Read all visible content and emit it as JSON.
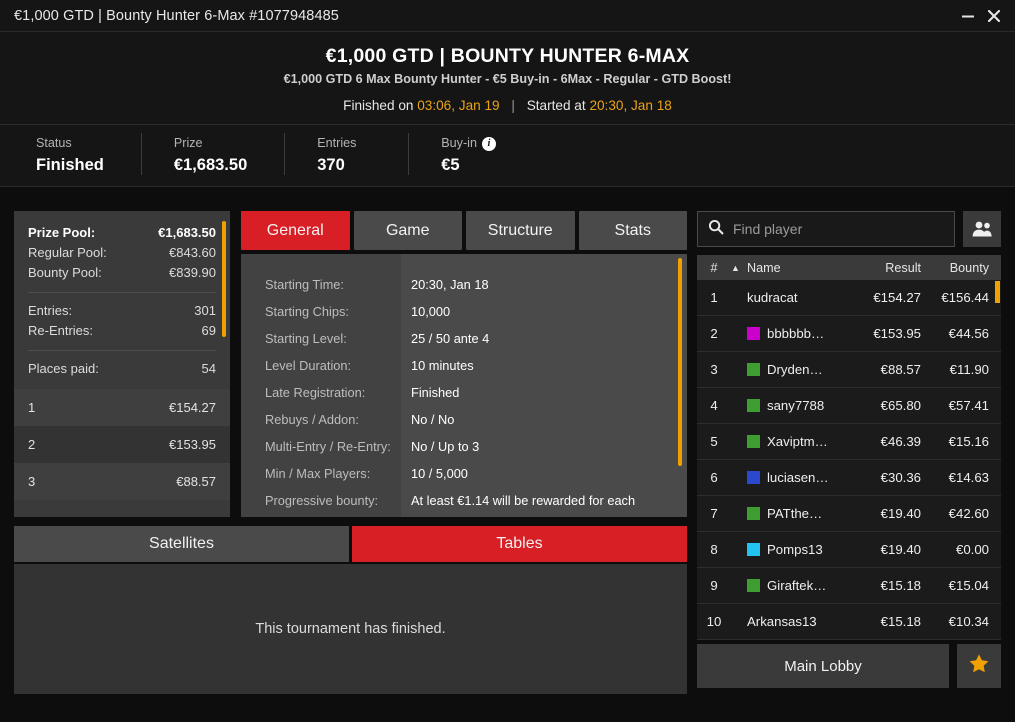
{
  "window": {
    "title": "€1,000 GTD | Bounty Hunter 6-Max #1077948485",
    "minimize_label": "minimize",
    "close_label": "close"
  },
  "header": {
    "title": "€1,000 GTD | BOUNTY HUNTER 6-MAX",
    "subtitle": "€1,000 GTD 6 Max Bounty Hunter - €5 Buy-in - 6Max - Regular - GTD Boost!",
    "finished_label": "Finished on",
    "finished_value": "03:06, Jan 19",
    "separator": "|",
    "started_label": "Started at",
    "started_value": "20:30, Jan 18",
    "accent_color": "#e8a317"
  },
  "stats": [
    {
      "label": "Status",
      "value": "Finished",
      "info": false
    },
    {
      "label": "Prize",
      "value": "€1,683.50",
      "info": false
    },
    {
      "label": "Entries",
      "value": "370",
      "info": false
    },
    {
      "label": "Buy-in",
      "value": "€5",
      "info": true,
      "info_glyph": "i"
    }
  ],
  "prize_panel": {
    "summary": [
      {
        "key": "Prize Pool:",
        "value": "€1,683.50",
        "bold": true
      },
      {
        "key": "Regular Pool:",
        "value": "€843.60",
        "bold": false
      },
      {
        "key": "Bounty Pool:",
        "value": "€839.90",
        "bold": false
      }
    ],
    "counts": [
      {
        "key": "Entries:",
        "value": "301"
      },
      {
        "key": "Re-Entries:",
        "value": "69"
      }
    ],
    "places": {
      "key": "Places paid:",
      "value": "54"
    },
    "payouts": [
      {
        "place": "1",
        "amount": "€154.27"
      },
      {
        "place": "2",
        "amount": "€153.95"
      },
      {
        "place": "3",
        "amount": "€88.57"
      }
    ],
    "scrollbar_color": "#f0a000"
  },
  "tabs": [
    {
      "label": "General",
      "active": true
    },
    {
      "label": "Game",
      "active": false
    },
    {
      "label": "Structure",
      "active": false
    },
    {
      "label": "Stats",
      "active": false
    }
  ],
  "general": {
    "rows": [
      {
        "label": "Starting Time:",
        "value": "20:30, Jan 18"
      },
      {
        "label": "Starting Chips:",
        "value": "10,000"
      },
      {
        "label": "Starting Level:",
        "value": "25 / 50 ante 4"
      },
      {
        "label": "Level Duration:",
        "value": "10 minutes"
      },
      {
        "label": "Late Registration:",
        "value": "Finished"
      },
      {
        "label": "Rebuys / Addon:",
        "value": "No / No"
      },
      {
        "label": "Multi-Entry / Re-Entry:",
        "value": "No / Up to 3"
      },
      {
        "label": "Min / Max Players:",
        "value": "10 / 5,000"
      },
      {
        "label": "Progressive bounty:",
        "value": "At least €1.14 will be rewarded for each"
      }
    ],
    "scrollbar_color": "#f0a000"
  },
  "subtabs": [
    {
      "label": "Satellites",
      "active": false
    },
    {
      "label": "Tables",
      "active": true
    }
  ],
  "tables_panel": {
    "message": "This tournament has finished."
  },
  "search": {
    "placeholder": "Find player",
    "value": "",
    "icon": "search-icon",
    "people_icon": "people-icon"
  },
  "player_table": {
    "columns": {
      "num": "#",
      "sort_glyph": "▲",
      "name": "Name",
      "result": "Result",
      "bounty": "Bounty"
    },
    "rows": [
      {
        "num": "1",
        "name": "kudracat",
        "color": "",
        "result": "€154.27",
        "bounty": "€156.44"
      },
      {
        "num": "2",
        "name": "bbbbbb…",
        "color": "#cc00cc",
        "result": "€153.95",
        "bounty": "€44.56"
      },
      {
        "num": "3",
        "name": "Dryden…",
        "color": "#3f9e32",
        "result": "€88.57",
        "bounty": "€11.90"
      },
      {
        "num": "4",
        "name": "sany7788",
        "color": "#3f9e32",
        "result": "€65.80",
        "bounty": "€57.41"
      },
      {
        "num": "5",
        "name": "Xaviptm…",
        "color": "#3f9e32",
        "result": "€46.39",
        "bounty": "€15.16"
      },
      {
        "num": "6",
        "name": "luciasen…",
        "color": "#2b49cc",
        "result": "€30.36",
        "bounty": "€14.63"
      },
      {
        "num": "7",
        "name": "PATthe…",
        "color": "#3f9e32",
        "result": "€19.40",
        "bounty": "€42.60"
      },
      {
        "num": "8",
        "name": "Pomps13",
        "color": "#22c3f0",
        "result": "€19.40",
        "bounty": "€0.00"
      },
      {
        "num": "9",
        "name": "Giraftek…",
        "color": "#3f9e32",
        "result": "€15.18",
        "bounty": "€15.04"
      },
      {
        "num": "10",
        "name": "Arkansas13",
        "color": "",
        "result": "€15.18",
        "bounty": "€10.34"
      }
    ],
    "scrollbar_color": "#f0a000"
  },
  "footer": {
    "lobby_label": "Main Lobby",
    "favorite_icon": "star-icon",
    "favorite_color": "#f0a000"
  },
  "theme": {
    "accent_red": "#d81f26",
    "accent_amber": "#f0a000",
    "background": "#0d0d0d"
  }
}
